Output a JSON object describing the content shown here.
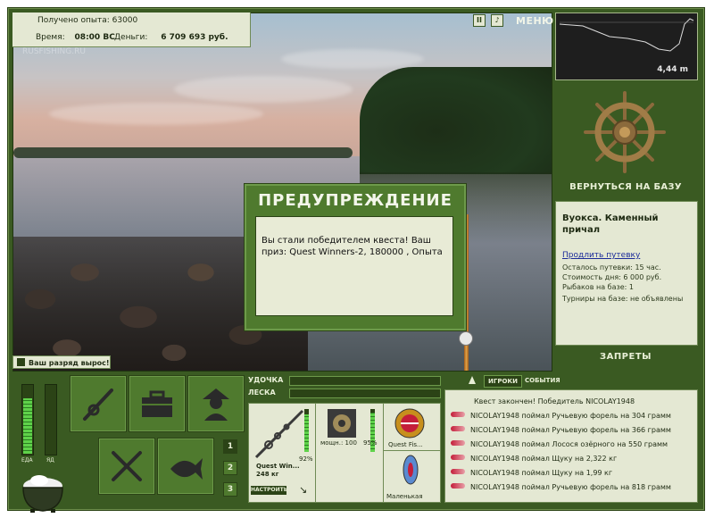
{
  "header": {
    "experience_label": "Получено опыта:",
    "experience_value": "63000",
    "time_label": "Время:",
    "time_value": "08:00 ВС",
    "money_label": "Деньги:",
    "money_value": "6 709 693 руб.",
    "menu_label": "МЕНЮ",
    "pause_icon": "pause-icon",
    "sound_icon": "sound-icon"
  },
  "scene": {
    "watermark": "RUSFISHING.RU",
    "rank_notice": "Ваш разряд вырос!"
  },
  "dialog": {
    "title": "ПРЕДУПРЕЖДЕНИЕ",
    "message": "Вы стали победителем квеста! Ваш приз: Quest Winners-2, 180000 , Опыта"
  },
  "depth_map": {
    "depth": "4,44 m"
  },
  "base": {
    "return_label": "ВЕРНУТЬСЯ НА БАЗУ",
    "name": "Вуокса. Каменный причал",
    "extend_link": "Продлить путевку",
    "info": [
      "Осталось путевки: 15 час.",
      "Стоимость дня: 6 000 руб.",
      "Рыбаков на базе: 1",
      "Турниры на базе: не объявлены"
    ],
    "bans_label": "ЗАПРЕТЫ"
  },
  "status": {
    "food_label": "ЕДА",
    "poison_label": "ЯД",
    "food_level": 0.82,
    "poison_level": 0.0
  },
  "pages": [
    "1",
    "2",
    "3"
  ],
  "tackle": {
    "rod_label": "УДОЧКА",
    "line_label": "ЛЕСКА",
    "rod_name": "Quest Win...",
    "rod_weight": "248 кг",
    "rod_percent": "92%",
    "reel_name": "мощн.: 100",
    "reel_percent": "95%",
    "lure1_name": "Quest Fis...",
    "lure2_name": "Маленькая",
    "tune_label": "НАСТРОИТЬ",
    "rod_level": 0.92,
    "reel_level": 0.95
  },
  "events": {
    "tab_players": "ИГРОКИ",
    "tab_events": "СОБЫТИЯ",
    "quest_line": "Квест закончен! Победитель NICOLAY1948",
    "catches": [
      "NICOLAY1948 поймал Ручьевую форель на 304 грамм",
      "NICOLAY1948 поймал Ручьевую форель на 366 грамм",
      "NICOLAY1948 поймал Лосося озёрного на 550 грамм",
      "NICOLAY1948 поймал Щуку на 2,322 кг",
      "NICOLAY1948 поймал Щуку на 1,99 кг",
      "NICOLAY1948 поймал Ручьевую форель на 818 грамм"
    ]
  }
}
